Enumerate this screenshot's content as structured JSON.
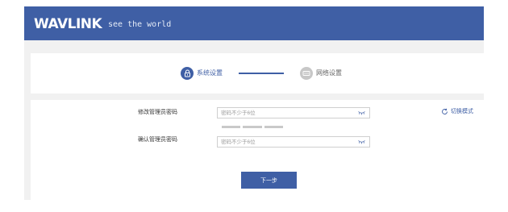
{
  "header": {
    "logo_text": "WAVLINK",
    "tagline": "see the world",
    "background_color": "#3f5fa5"
  },
  "steps": [
    {
      "label": "系统设置",
      "icon": "lock-icon",
      "state": "active"
    },
    {
      "label": "网络设置",
      "icon": "network-icon",
      "state": "inactive"
    }
  ],
  "form": {
    "admin_password": {
      "label": "修改管理员密码",
      "placeholder": "密码不少于6位",
      "value": "",
      "icon": "eye-closed-icon"
    },
    "password_strength": {
      "segments": 3,
      "filled": 0
    },
    "confirm_password": {
      "label": "确认管理员密码",
      "placeholder": "密码不少于6位",
      "value": "",
      "icon": "eye-closed-icon"
    },
    "switch_mode": {
      "label": "切换模式",
      "icon": "refresh-icon"
    },
    "next_button": {
      "label": "下一步"
    }
  },
  "colors": {
    "accent": "#3f5fa5",
    "inactive": "#c7c7c7",
    "page_background": "#f1f1f1"
  }
}
